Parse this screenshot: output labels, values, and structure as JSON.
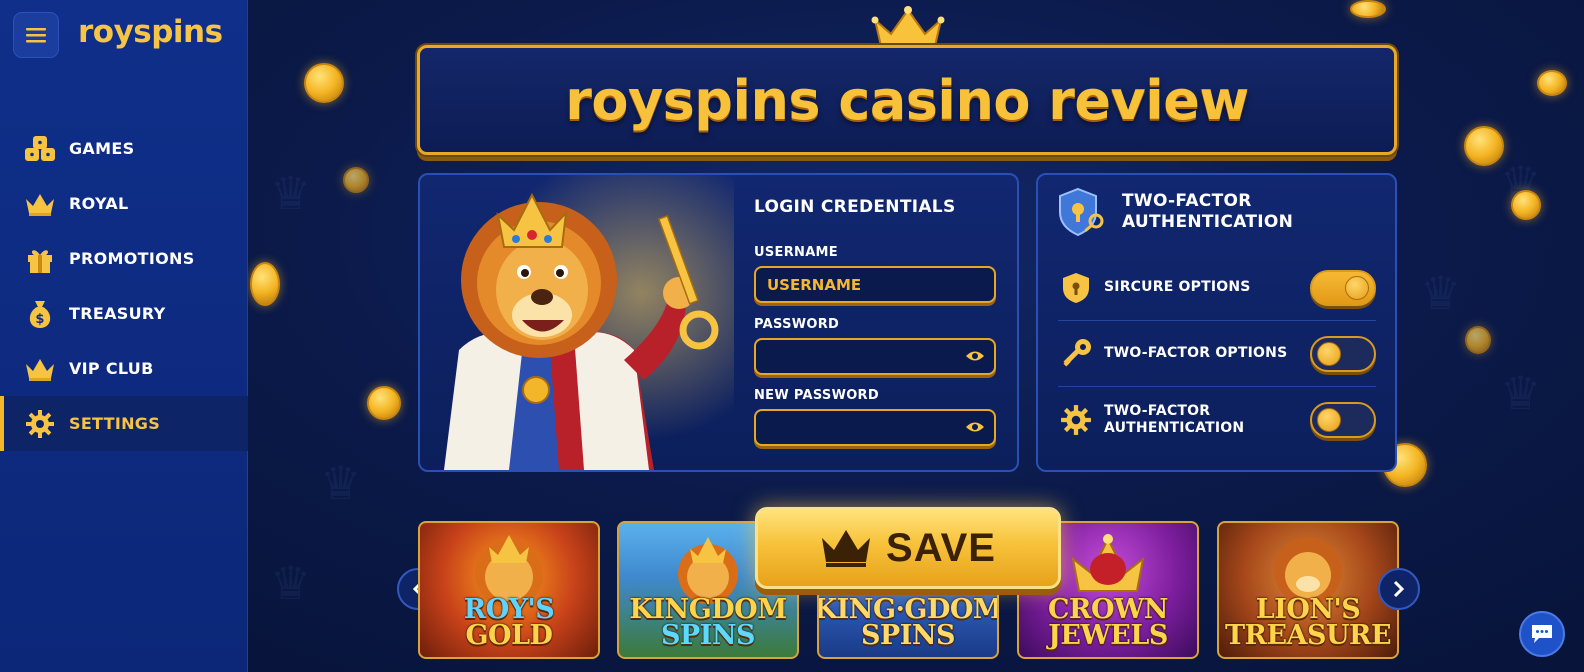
{
  "brand": {
    "name": "royspins"
  },
  "sidebar": {
    "items": [
      {
        "label": "GAMES",
        "icon": "dice-icon"
      },
      {
        "label": "ROYAL",
        "icon": "crown-icon"
      },
      {
        "label": "PROMOTIONS",
        "icon": "gift-icon"
      },
      {
        "label": "TREASURY",
        "icon": "money-bag-icon"
      },
      {
        "label": "VIP CLUB",
        "icon": "crown-icon"
      },
      {
        "label": "SETTINGS",
        "icon": "gear-icon",
        "active": true
      }
    ]
  },
  "page": {
    "title": "royspins casino review"
  },
  "login": {
    "title": "LOGIN CREDENTIALS",
    "username_label": "USERNAME",
    "username_value": "USERNAME",
    "password_label": "PASSWORD",
    "new_password_label": "NEW PASSWORD"
  },
  "tfa": {
    "title_line1": "TWO-FACTOR",
    "title_line2": "AUTHENTICATION",
    "rows": [
      {
        "label": "SIRCURE OPTIONS",
        "icon": "shield-icon",
        "on": true
      },
      {
        "label": "TWO-FACTOR OPTIONS",
        "icon": "key-icon",
        "on": false
      },
      {
        "label_line1": "TWO-FACTOR",
        "label_line2": "AUTHENTICATION",
        "icon": "gear-icon",
        "on": false
      }
    ]
  },
  "actions": {
    "save_label": "SAVE"
  },
  "games": [
    {
      "line1": "ROY'S",
      "line2": "GOLD"
    },
    {
      "line1": "KINGDOM",
      "line2": "SPINS"
    },
    {
      "line1": "KING·GDOM",
      "line2": "SPINS"
    },
    {
      "line1": "CROWN",
      "line2": "JEWELS"
    },
    {
      "line1": "LION'S",
      "line2": "TREASURE"
    }
  ],
  "colors": {
    "accent": "#f6c343",
    "sidebar": "#0f2f8a",
    "background": "#0b1a4a"
  }
}
